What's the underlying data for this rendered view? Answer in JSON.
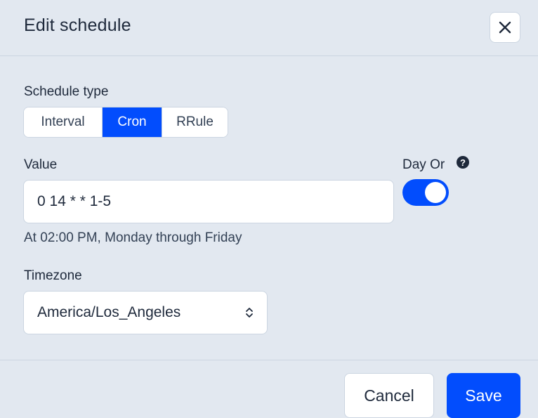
{
  "dialog": {
    "title": "Edit schedule"
  },
  "schedule_type": {
    "label": "Schedule type",
    "options": [
      "Interval",
      "Cron",
      "RRule"
    ],
    "selected": "Cron"
  },
  "value": {
    "label": "Value",
    "input_value": "0 14 * * 1-5",
    "description": "At 02:00 PM, Monday through Friday"
  },
  "day_or": {
    "label": "Day Or",
    "help_icon": "question-circle-icon",
    "enabled": true
  },
  "timezone": {
    "label": "Timezone",
    "selected": "America/Los_Angeles"
  },
  "footer": {
    "cancel_label": "Cancel",
    "save_label": "Save"
  },
  "colors": {
    "accent": "#024dfd",
    "background": "#e2e8f0",
    "border": "#cbd5e1"
  }
}
